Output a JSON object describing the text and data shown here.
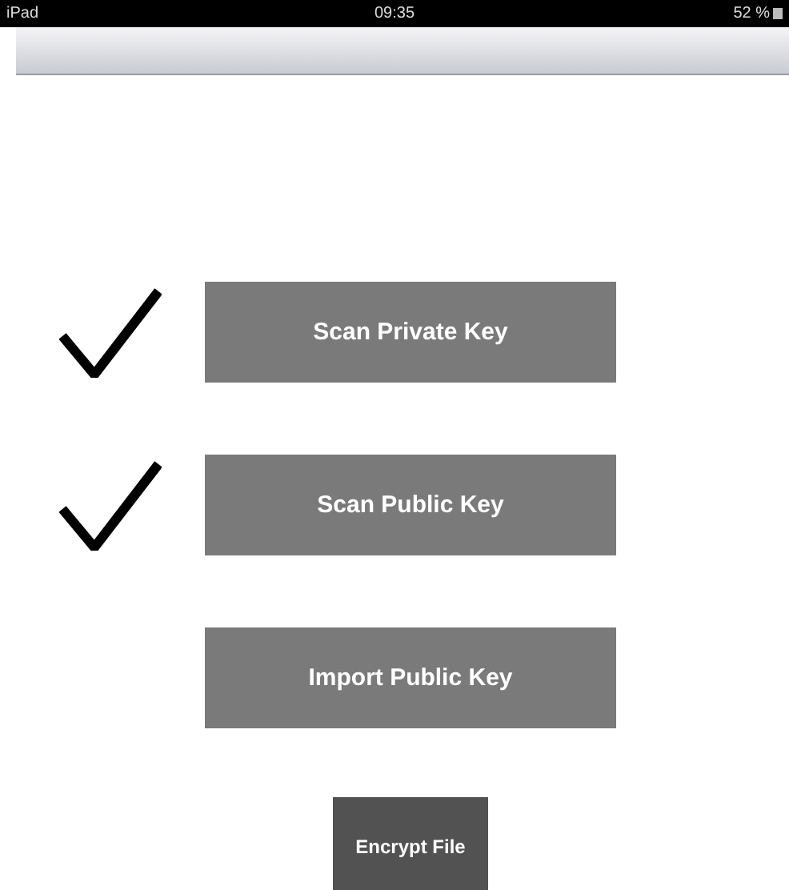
{
  "status_bar": {
    "device": "iPad",
    "time": "09:35",
    "battery": "52 %"
  },
  "key_buttons": [
    {
      "label": "Scan Private Key",
      "done": true
    },
    {
      "label": "Scan Public Key",
      "done": true
    },
    {
      "label": "Import Public Key",
      "done": false
    }
  ],
  "encrypt_button": {
    "label": "Encrypt File"
  }
}
